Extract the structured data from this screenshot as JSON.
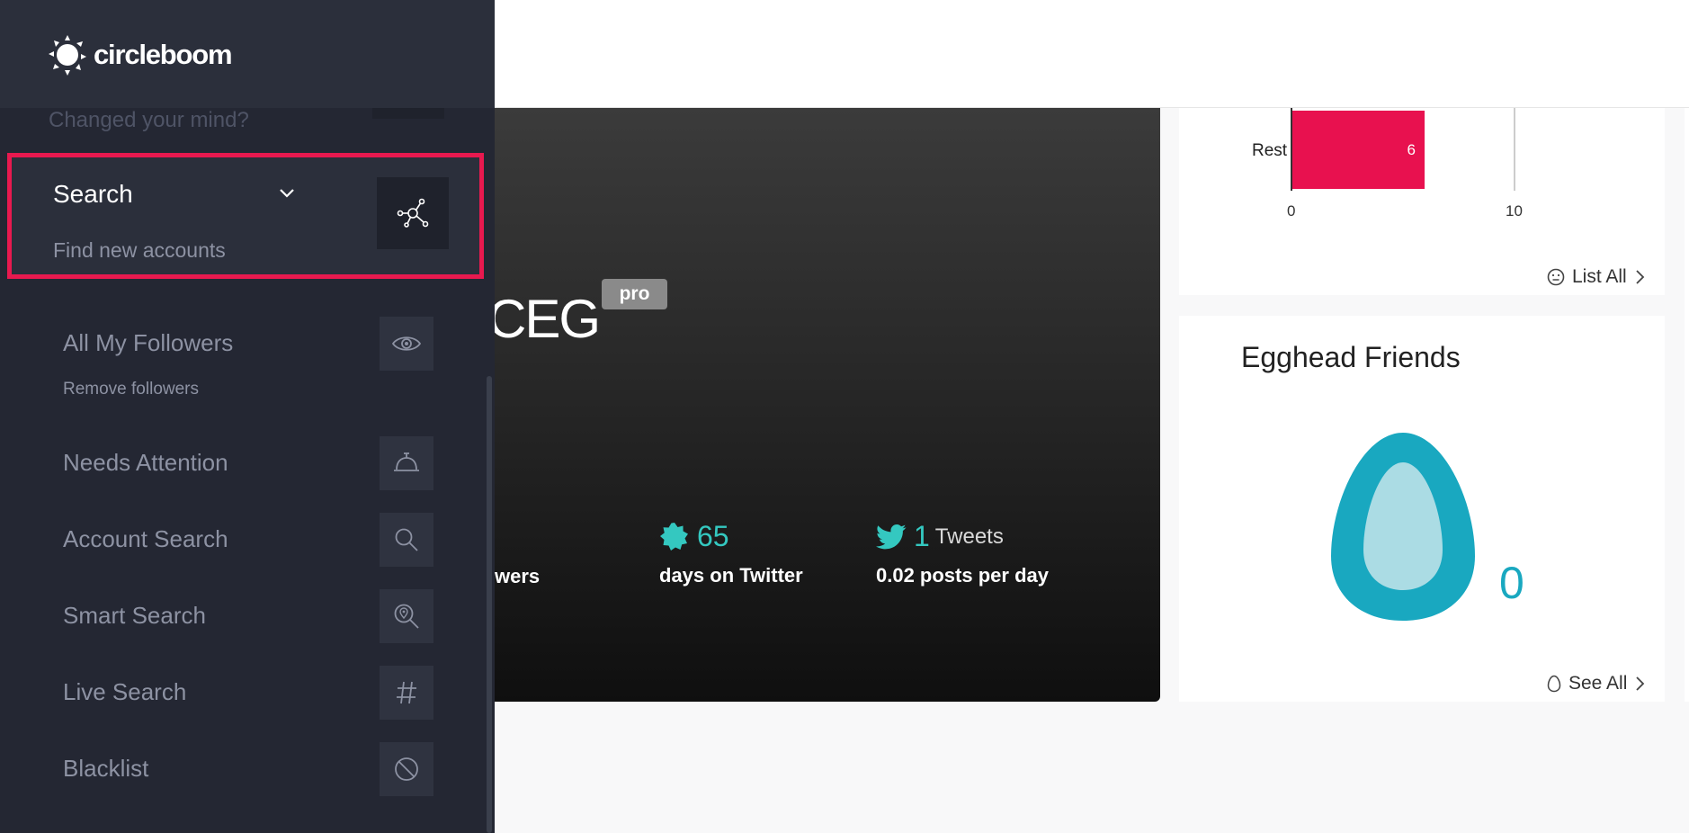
{
  "brand": {
    "name": "circleboom"
  },
  "sidebar": {
    "previous_hint": "Changed your mind?",
    "active_section": {
      "title": "Search",
      "subtitle": "Find new accounts",
      "icon": "network-icon"
    },
    "items": [
      {
        "label": "All My Followers",
        "sub": "Remove followers",
        "icon": "eye-icon"
      },
      {
        "label": "Needs Attention",
        "icon": "bell-icon"
      },
      {
        "label": "Account Search",
        "icon": "search-icon"
      },
      {
        "label": "Smart Search",
        "icon": "location-search-icon"
      },
      {
        "label": "Live Search",
        "icon": "hashtag-icon"
      },
      {
        "label": "Blacklist",
        "icon": "block-icon"
      }
    ]
  },
  "profile": {
    "name_fragment": "CEG",
    "badge": "pro",
    "followers_fragment": "wers",
    "days": {
      "value": "65",
      "caption": "days on Twitter"
    },
    "tweets": {
      "value": "1",
      "word": "Tweets",
      "caption": "0.02 posts per day"
    }
  },
  "card1": {
    "link": "List All"
  },
  "chart_data": {
    "type": "bar",
    "orientation": "horizontal",
    "categories": [
      "Rest"
    ],
    "values": [
      6
    ],
    "xlim": [
      0,
      10
    ],
    "ticks": [
      "0",
      "10"
    ]
  },
  "card2": {
    "title": "Egghead Friends",
    "count": "0",
    "link": "See All"
  },
  "colors": {
    "accent": "#e8194f",
    "teal": "#34c8c0",
    "egg": "#19a8c0",
    "sidebar": "#242733"
  }
}
